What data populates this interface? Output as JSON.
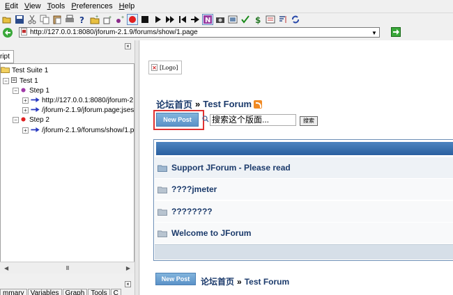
{
  "menu": {
    "items": [
      {
        "label": "Edit"
      },
      {
        "label": "View"
      },
      {
        "label": "Tools"
      },
      {
        "label": "Preferences"
      },
      {
        "label": "Help"
      }
    ]
  },
  "addressbar": {
    "url": "http://127.0.0.1:8080/jforum-2.1.9/forums/show/1.page"
  },
  "left_panel": {
    "tab_label": "ript",
    "tree": {
      "suite": "Test Suite 1",
      "test": "Test 1",
      "step1": "Step 1",
      "step1_item1": "http://127.0.0.1:8080/jforum-2.",
      "step1_item2": "/jforum-2.1.9/jforum.page;jses",
      "step2": "Step 2",
      "step2_item1": "/jforum-2.1.9/forums/show/1.p"
    },
    "scroll_grip": "III",
    "bottom_tabs": [
      {
        "label": "mmary"
      },
      {
        "label": "Variables"
      },
      {
        "label": "Graph"
      },
      {
        "label": "Tools"
      },
      {
        "label": "C"
      }
    ]
  },
  "page": {
    "logo_alt": "[Logo]",
    "breadcrumb": {
      "home": "论坛首页",
      "separator": "»",
      "forum": "Test Forum"
    },
    "new_post_label": "New Post",
    "search_placeholder": "搜索这个版面...",
    "search_button": "搜索",
    "forums": [
      {
        "title": "Support JForum - Please read"
      },
      {
        "title": "????jmeter"
      },
      {
        "title": "????????"
      },
      {
        "title": "Welcome to JForum"
      }
    ]
  },
  "colors": {
    "accent_blue": "#1b3a6b",
    "table_header": "#2a5f9f",
    "highlight_red": "#e03030",
    "button_blue": "#5b92c8"
  }
}
